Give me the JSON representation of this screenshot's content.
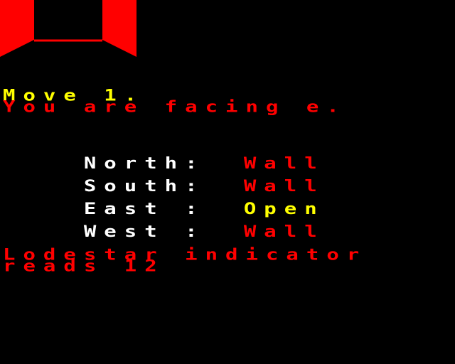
{
  "game": {
    "move_text": "Move 1.",
    "facing_text": "You are facing e.",
    "directions": [
      {
        "label": "North:",
        "status": "Wall",
        "status_color": "#ff0000"
      },
      {
        "label": "South:",
        "status": "Wall",
        "status_color": "#ff0000"
      },
      {
        "label": "East :",
        "status": "Open",
        "status_color": "#ffff00"
      },
      {
        "label": "West :",
        "status": "Wall",
        "status_color": "#ff0000"
      }
    ],
    "indicator_line1": "Lodestar indicator",
    "indicator_line2": "reads 12"
  },
  "colors": {
    "background": "#000000",
    "wall": "#ff0000",
    "move": "#ffff00",
    "label": "#ffffff",
    "open": "#ffff00"
  }
}
